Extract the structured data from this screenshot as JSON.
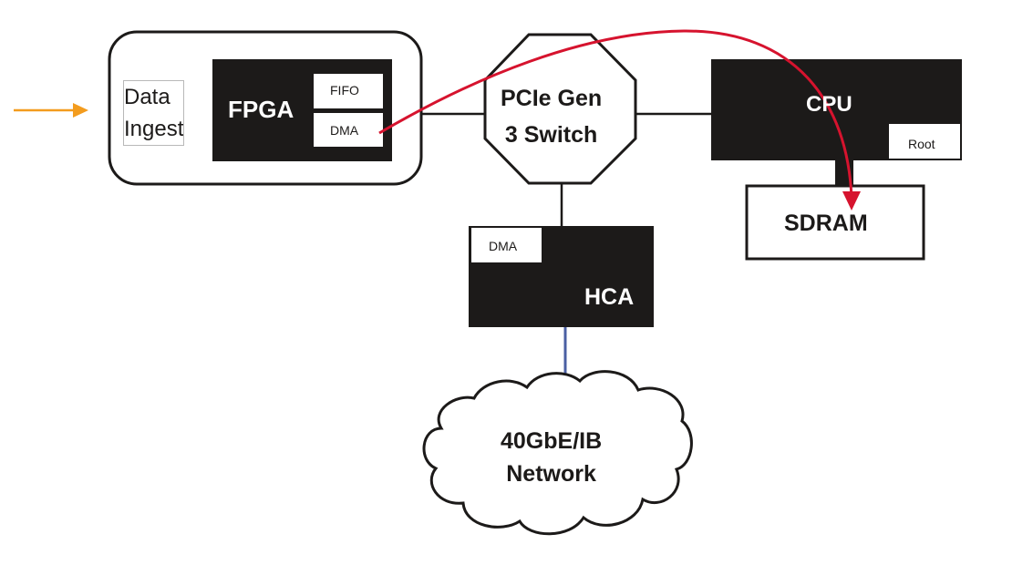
{
  "diagram": {
    "input_arrow_color": "#f39c1e",
    "dataflow_arrow_color": "#d6132e",
    "network_link_color": "#4a5fa3",
    "block_fill": "#1c1a19",
    "nodes": {
      "data_ingest": {
        "line1": "Data",
        "line2": "Ingest"
      },
      "fpga": {
        "label": "FPGA",
        "fifo": "FIFO",
        "dma": "DMA"
      },
      "pcie_switch": {
        "line1": "PCIe Gen",
        "line2": "3 Switch"
      },
      "cpu": {
        "label": "CPU",
        "root": "Root"
      },
      "sdram": {
        "label": "SDRAM"
      },
      "hca": {
        "label": "HCA",
        "dma": "DMA"
      },
      "network": {
        "line1": "40GbE/IB",
        "line2": "Network"
      }
    },
    "edges": [
      {
        "from": "external",
        "to": "data_ingest",
        "style": "orange-arrow"
      },
      {
        "from": "fpga",
        "to": "pcie_switch",
        "style": "line"
      },
      {
        "from": "pcie_switch",
        "to": "cpu",
        "style": "line"
      },
      {
        "from": "pcie_switch",
        "to": "hca",
        "style": "line"
      },
      {
        "from": "cpu",
        "to": "sdram",
        "style": "thick-line"
      },
      {
        "from": "hca",
        "to": "network",
        "style": "blue-line"
      },
      {
        "from": "fpga.dma",
        "to": "sdram",
        "style": "red-curved-arrow"
      }
    ]
  }
}
